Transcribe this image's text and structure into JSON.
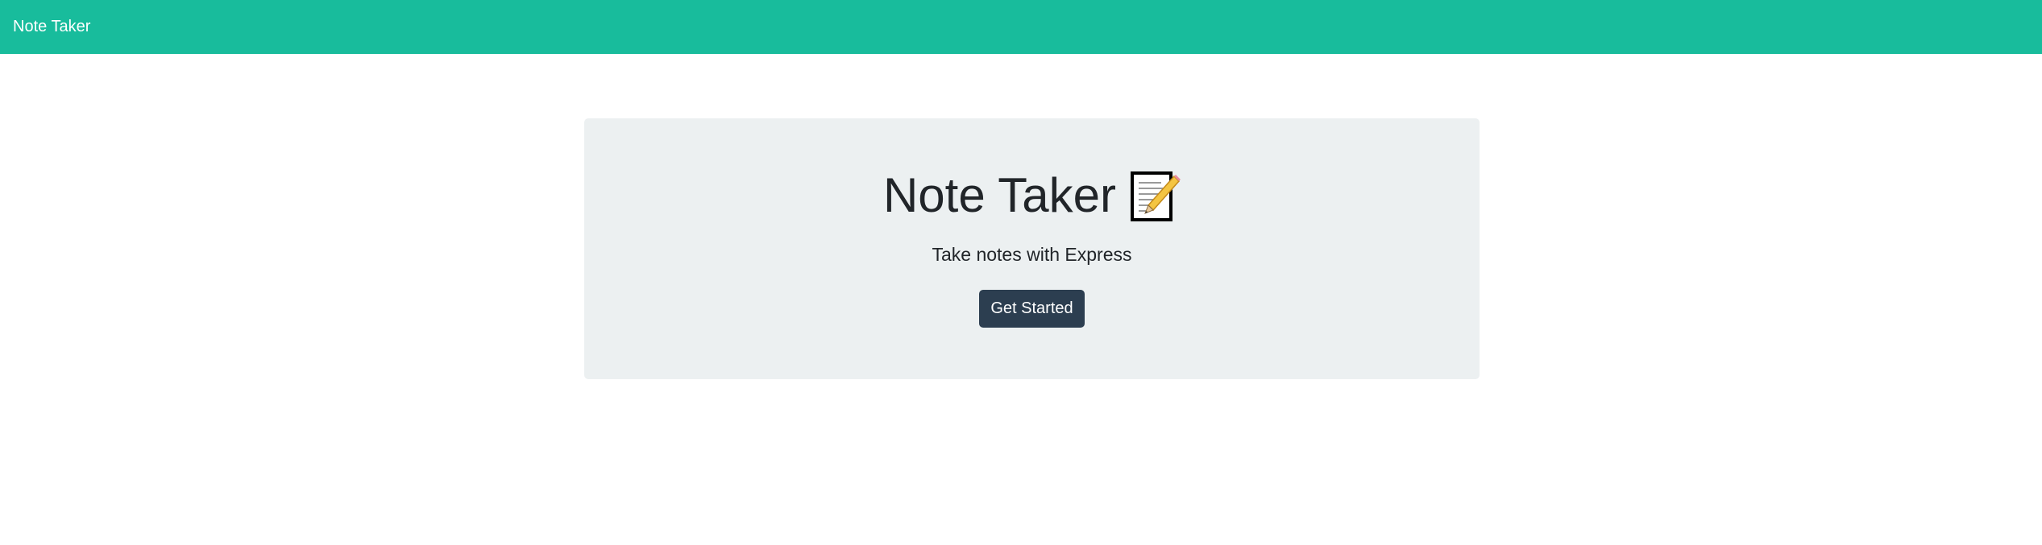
{
  "navbar": {
    "brand": "Note Taker",
    "background_color": "#18bc9c"
  },
  "hero": {
    "title": "Note Taker",
    "title_icon": "memo-icon",
    "subtitle": "Take notes with Express",
    "cta_label": "Get Started",
    "cta_color": "#2c3e50",
    "panel_color": "#ecf0f1"
  }
}
